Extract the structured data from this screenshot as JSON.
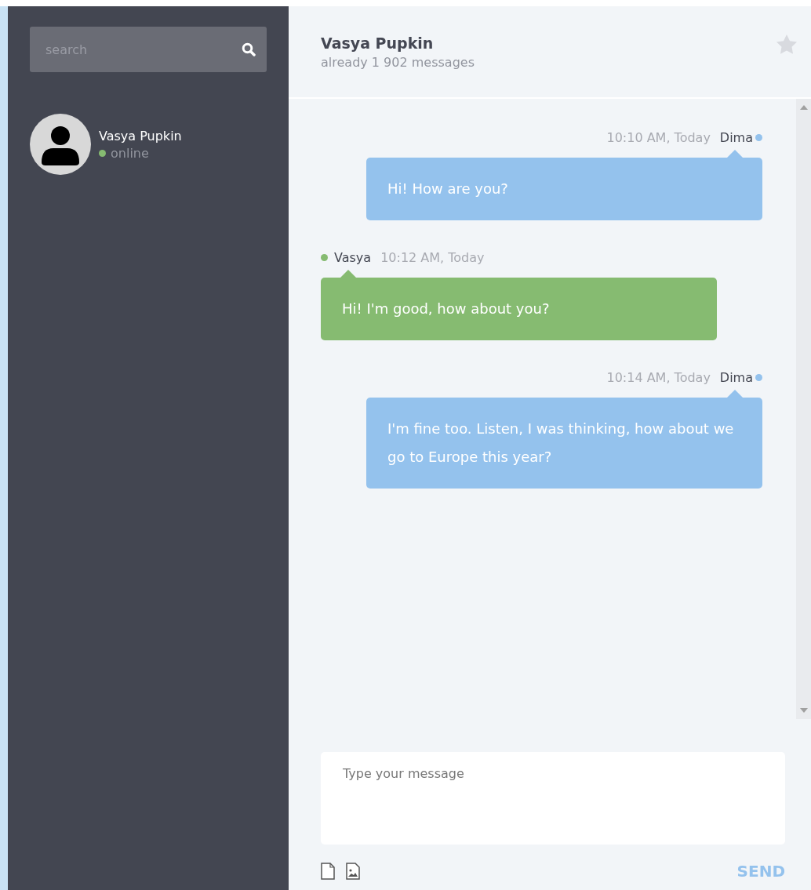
{
  "sidebar": {
    "search": {
      "placeholder": "search"
    },
    "contacts": [
      {
        "name": "Vasya Pupkin",
        "status": "online",
        "color": "#86bb71"
      }
    ]
  },
  "chat": {
    "title": "Vasya Pupkin",
    "subtitle": "already 1 902 messages",
    "messages": [
      {
        "kind": "sent",
        "author": "Dima",
        "time": "10:10 AM, Today",
        "text": "Hi! How are you?",
        "color": "#94c2ed"
      },
      {
        "kind": "received",
        "author": "Vasya",
        "time": "10:12 AM, Today",
        "text": "Hi! I'm good, how about you?",
        "color": "#86bb71"
      },
      {
        "kind": "sent",
        "author": "Dima",
        "time": "10:14 AM, Today",
        "text": "I'm fine too. Listen, I was thinking, how about we go to Europe this year?",
        "color": "#94c2ed"
      }
    ],
    "composer": {
      "placeholder": "Type your message",
      "send": "SEND"
    }
  }
}
